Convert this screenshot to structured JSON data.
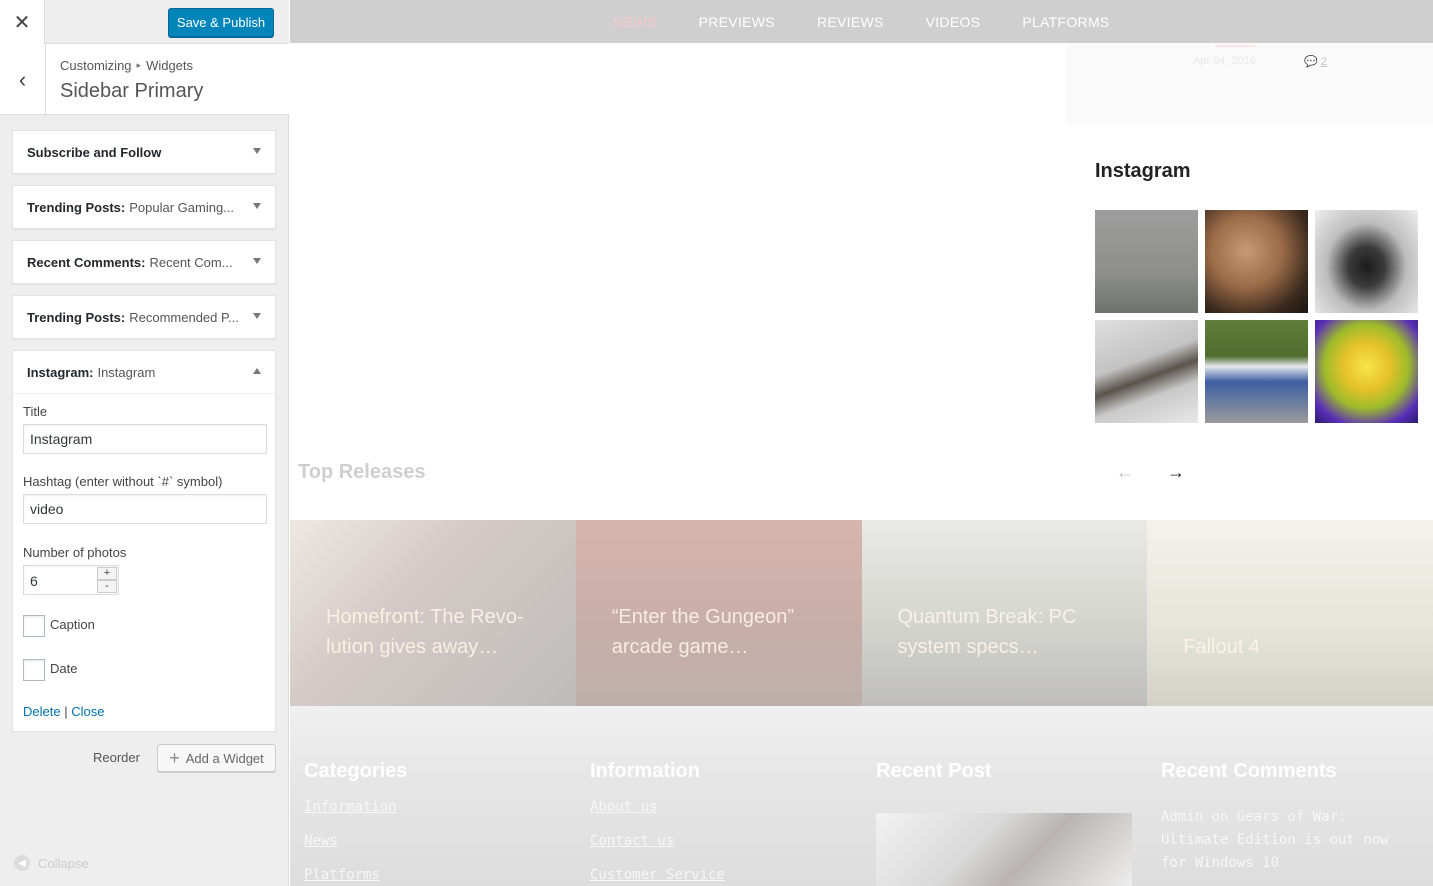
{
  "customizer": {
    "publish_label": "Save & Publish",
    "breadcrumb": {
      "root": "Customizing",
      "separator": "▸",
      "current": "Widgets"
    },
    "section_title": "Sidebar Primary",
    "widgets": [
      {
        "name": "Subscribe and Follow",
        "subtitle": "",
        "expanded": false
      },
      {
        "name": "Trending Posts:",
        "subtitle": "Popular Gaming...",
        "expanded": false
      },
      {
        "name": "Recent Comments:",
        "subtitle": "Recent Com...",
        "expanded": false
      },
      {
        "name": "Trending Posts:",
        "subtitle": "Recommended P...",
        "expanded": false
      },
      {
        "name": "Instagram:",
        "subtitle": "Instagram",
        "expanded": true
      }
    ],
    "instagram_form": {
      "title_label": "Title",
      "title_value": "Instagram",
      "hashtag_label": "Hashtag (enter without `#` symbol)",
      "hashtag_value": "video",
      "photos_label": "Number of photos",
      "photos_value": "6",
      "caption_label": "Caption",
      "date_label": "Date",
      "delete_label": "Delete",
      "separator": "|",
      "close_label": "Close"
    },
    "reorder_label": "Reorder",
    "add_widget_label": "Add a Widget",
    "collapse_label": "Collapse"
  },
  "preview": {
    "nav": [
      "NEWS",
      "PREVIEWS",
      "REVIEWS",
      "VIDEOS",
      "PLATFORMS"
    ],
    "post_meta": {
      "date": "Apr 04, 2016",
      "comments": "2"
    },
    "instagram_title": "Instagram",
    "top_releases_title": "Top Releases",
    "releases": [
      "Homefront: The Revo-lution gives away…",
      "“Enter the Gungeon” arcade game…",
      "Quantum Break: PC system specs…",
      "Fallout 4"
    ],
    "footer": {
      "categories": {
        "title": "Categories",
        "links": [
          "Information",
          "News",
          "Platforms"
        ]
      },
      "information": {
        "title": "Information",
        "links": [
          "About us",
          "Contact us",
          "Customer Service"
        ]
      },
      "recent_post": {
        "title": "Recent Post"
      },
      "recent_comments": {
        "title": "Recent Comments",
        "text": "Admin on Gears of War: Ultimate Edition is out now for Windows 10"
      }
    }
  },
  "colors": {
    "primary_button": "#0085ba",
    "link": "#0073aa",
    "nav_active": "#f8c7cf"
  }
}
